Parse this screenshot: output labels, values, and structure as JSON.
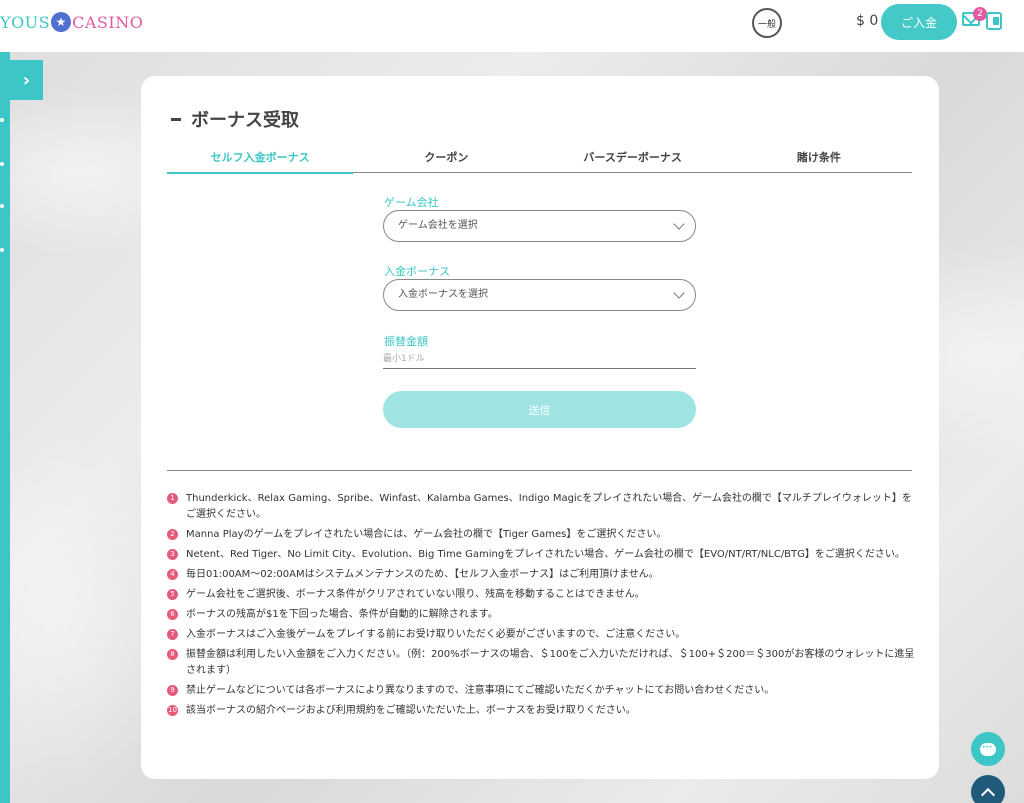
{
  "header": {
    "logo_left": "YOUS",
    "logo_star": "★",
    "logo_right": "CASINO",
    "lang_label": "一般",
    "balance": "$ 0",
    "deposit_label": "ご入金",
    "mail_badge_count": "2"
  },
  "sidebar": {
    "expand_icon": "›"
  },
  "page": {
    "title": "ボーナス受取",
    "tabs": [
      {
        "label": "セルフ入金ボーナス",
        "active": true
      },
      {
        "label": "クーポン",
        "active": false
      },
      {
        "label": "バースデーボーナス",
        "active": false
      },
      {
        "label": "賭け条件",
        "active": false
      }
    ]
  },
  "form": {
    "game_company_label": "ゲーム会社",
    "game_company_placeholder": "ゲーム会社を選択",
    "deposit_bonus_label": "入金ボーナス",
    "deposit_bonus_placeholder": "入金ボーナスを選択",
    "amount_label": "振替金額",
    "amount_placeholder": "最小1ドル",
    "submit_label": "送信"
  },
  "notes": [
    {
      "num": "1",
      "text": "Thunderkick、Relax Gaming、Spribe、Winfast、Kalamba Games、Indigo Magicをプレイされたい場合、ゲーム会社の欄で【マルチプレイウォレット】をご選択ください。"
    },
    {
      "num": "2",
      "text": "Manna Playのゲームをプレイされたい場合には、ゲーム会社の欄で【Tiger Games】をご選択ください。"
    },
    {
      "num": "3",
      "text": "Netent、Red Tiger、No Limit City、Evolution、Big Time Gamingをプレイされたい場合、ゲーム会社の欄で【EVO/NT/RT/NLC/BTG】をご選択ください。"
    },
    {
      "num": "4",
      "text": "毎日01:00AM〜02:00AMはシステムメンテナンスのため、【セルフ入金ボーナス】はご利用頂けません。"
    },
    {
      "num": "5",
      "text": "ゲーム会社をご選択後、ボーナス条件がクリアされていない限り、残高を移動することはできません。"
    },
    {
      "num": "6",
      "text": "ボーナスの残高が$1を下回った場合、条件が自動的に解除されます。"
    },
    {
      "num": "7",
      "text": "入金ボーナスはご入金後ゲームをプレイする前にお受け取りいただく必要がございますので、ご注意ください。"
    },
    {
      "num": "8",
      "text": "振替金額は利用したい入金額をご入力ください。（例：200%ボーナスの場合、＄100をご入力いただければ、＄100+＄200＝＄300がお客様のウォレットに進呈されます）"
    },
    {
      "num": "9",
      "text": "禁止ゲームなどについては各ボーナスにより異なりますので、注意事項にてご確認いただくかチャットにてお問い合わせください。"
    },
    {
      "num": "10",
      "text": "該当ボーナスの紹介ページおよび利用規約をご確認いただいた上、ボーナスをお受け取りください。"
    }
  ],
  "colors": {
    "accent": "#3cc6c6",
    "badge": "#e35a7a",
    "submit_disabled": "#9fe3e3"
  }
}
